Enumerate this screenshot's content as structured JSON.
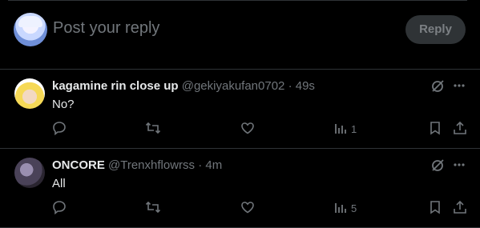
{
  "composer": {
    "placeholder": "Post your reply",
    "reply_label": "Reply"
  },
  "tweets": [
    {
      "name": "kagamine rin close up",
      "handle": "@gekiyakufan0702",
      "separator": "·",
      "time": "49s",
      "text": "No?",
      "views": "1"
    },
    {
      "name": "ONCORE",
      "handle": "@Trenxhflowrss",
      "separator": "·",
      "time": "4m",
      "text": "All",
      "views": "5"
    }
  ],
  "colors": {
    "background": "#000000",
    "text": "#e7e9ea",
    "muted": "#71767b",
    "border": "#2f3336",
    "button_bg": "#2f3336"
  },
  "icons": [
    "reply-icon",
    "retweet-icon",
    "like-icon",
    "views-icon",
    "bookmark-icon",
    "share-icon",
    "grok-icon",
    "more-icon"
  ]
}
